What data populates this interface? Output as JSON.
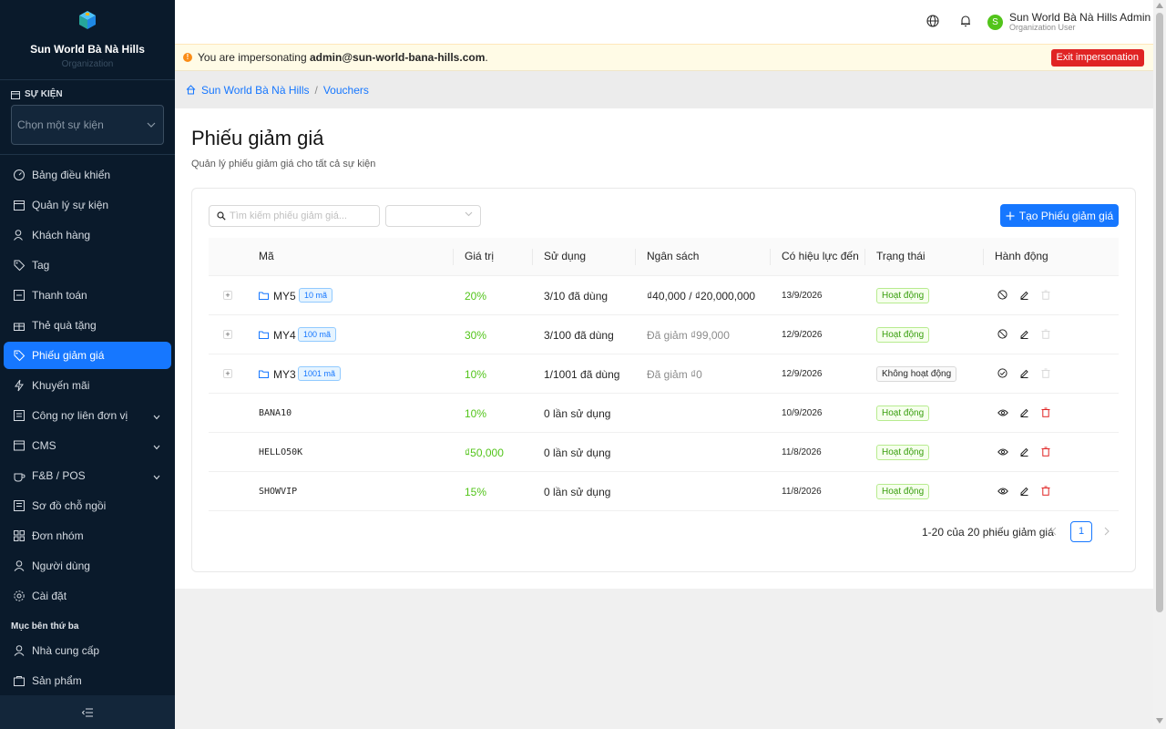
{
  "sidebar": {
    "org_name": "Sun World Bà Nà Hills",
    "org_sub": "Organization",
    "event_label": "SỰ KIỆN",
    "event_placeholder": "Chọn một sự kiện",
    "items": [
      {
        "label": "Bảng điều khiển",
        "icon": "dashboard-icon"
      },
      {
        "label": "Quản lý sự kiện",
        "icon": "calendar-icon"
      },
      {
        "label": "Khách hàng",
        "icon": "user-icon"
      },
      {
        "label": "Tag",
        "icon": "tag-icon"
      },
      {
        "label": "Thanh toán",
        "icon": "payment-icon"
      },
      {
        "label": "Thẻ quà tặng",
        "icon": "gift-icon"
      },
      {
        "label": "Phiếu giảm giá",
        "icon": "voucher-icon",
        "active": true
      },
      {
        "label": "Khuyến mãi",
        "icon": "bolt-icon"
      },
      {
        "label": "Công nợ liên đơn vị",
        "icon": "ledger-icon",
        "expandable": true
      },
      {
        "label": "CMS",
        "icon": "cms-icon",
        "expandable": true
      },
      {
        "label": "F&B / POS",
        "icon": "coffee-icon",
        "expandable": true
      },
      {
        "label": "Sơ đồ chỗ ngồi",
        "icon": "seat-map-icon"
      },
      {
        "label": "Đơn nhóm",
        "icon": "group-order-icon"
      },
      {
        "label": "Người dùng",
        "icon": "users-icon"
      },
      {
        "label": "Cài đặt",
        "icon": "settings-icon"
      }
    ],
    "third_party_title": "Mục bên thứ ba",
    "third_party_items": [
      {
        "label": "Nhà cung cấp",
        "icon": "supplier-icon"
      },
      {
        "label": "Sản phẩm",
        "icon": "product-icon"
      }
    ]
  },
  "topbar": {
    "user_name": "Sun World Bà Nà Hills Admin",
    "user_role": "Organization User",
    "avatar_letter": "S"
  },
  "impersonation": {
    "prefix": "You are impersonating ",
    "email": "admin@sun-world-bana-hills.com",
    "suffix": ".",
    "exit_label": "Exit impersonation"
  },
  "breadcrumb": {
    "home": "Sun World Bà Nà Hills",
    "separator": "/",
    "current": "Vouchers"
  },
  "page": {
    "title": "Phiếu giảm giá",
    "subtitle": "Quản lý phiếu giảm giá cho tất cả sự kiện",
    "search_placeholder": "Tìm kiếm phiếu giảm giá...",
    "create_label": "Tạo Phiếu giảm giá"
  },
  "table": {
    "headers": [
      "Mã",
      "Giá trị",
      "Sử dụng",
      "Ngân sách",
      "Có hiệu lực đến",
      "Trạng thái",
      "Hành động"
    ],
    "rows": [
      {
        "code": "MY5",
        "group": true,
        "count": "10 mã",
        "value": "20%",
        "usage": "3/10 đã dùng",
        "budget": "₫40,000 / ₫20,000,000",
        "budget_muted": false,
        "date": "13/9/2026",
        "status": "Hoạt động",
        "active": true
      },
      {
        "code": "MY4",
        "group": true,
        "count": "100 mã",
        "value": "30%",
        "usage": "3/100 đã dùng",
        "budget": "Đã giảm ₫99,000",
        "budget_muted": true,
        "date": "12/9/2026",
        "status": "Hoạt động",
        "active": true
      },
      {
        "code": "MY3",
        "group": true,
        "count": "1001 mã",
        "value": "10%",
        "usage": "1/1001 đã dùng",
        "budget": "Đã giảm ₫0",
        "budget_muted": true,
        "date": "12/9/2026",
        "status": "Không hoạt động",
        "active": false
      },
      {
        "code": "BANA10",
        "group": false,
        "value": "10%",
        "usage": "0 lần sử dụng",
        "budget": "",
        "date": "10/9/2026",
        "status": "Hoạt động",
        "active": true
      },
      {
        "code": "HELLO50K",
        "group": false,
        "value": "₫50,000",
        "usage": "0 lần sử dụng",
        "budget": "",
        "date": "11/8/2026",
        "status": "Hoạt động",
        "active": true
      },
      {
        "code": "SHOWVIP",
        "group": false,
        "value": "15%",
        "usage": "0 lần sử dụng",
        "budget": "",
        "date": "11/8/2026",
        "status": "Hoạt động",
        "active": true
      }
    ]
  },
  "pagination": {
    "summary": "1-20 của 20 phiếu giảm giá",
    "current": "1"
  },
  "colors": {
    "primary": "#1677ff",
    "sidebar_bg": "#0a1a2b",
    "success": "#52c41a",
    "danger": "#e02424"
  }
}
